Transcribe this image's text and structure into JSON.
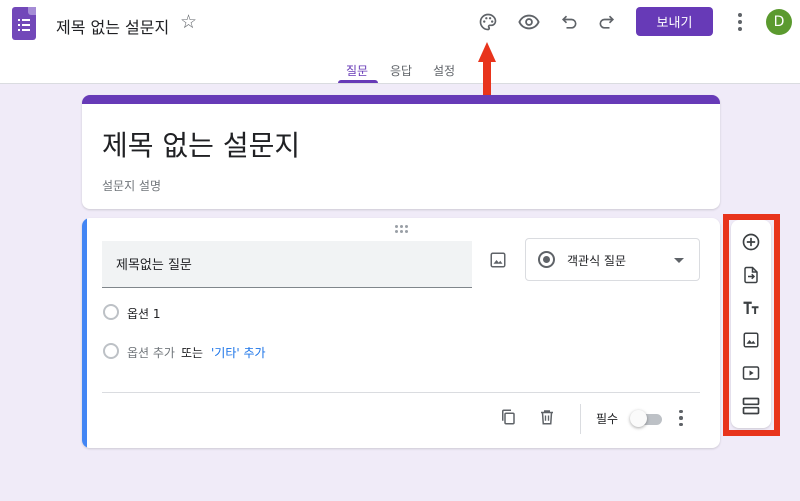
{
  "header": {
    "doc_title": "제목 없는 설문지",
    "send_label": "보내기",
    "avatar_initial": "D",
    "icons": [
      "forms-logo-icon",
      "star-icon",
      "palette-icon",
      "preview-eye-icon",
      "undo-icon",
      "redo-icon",
      "more-vert-icon"
    ]
  },
  "tabs": [
    {
      "label": "질문",
      "active": true
    },
    {
      "label": "응답",
      "active": false
    },
    {
      "label": "설정",
      "active": false
    }
  ],
  "form": {
    "title": "제목 없는 설문지",
    "description": "설문지 설명"
  },
  "question": {
    "title": "제목없는 질문",
    "type": "객관식 질문",
    "options": [
      "옵션 1"
    ],
    "add_option": "옵션 추가",
    "or_text": "또는",
    "add_other": "'기타' 추가",
    "required_label": "필수",
    "required": false
  },
  "side_toolbar": [
    "add-question-icon",
    "import-questions-icon",
    "add-title-text-icon",
    "add-image-icon",
    "add-video-icon",
    "add-section-icon"
  ],
  "colors": {
    "accent": "#673ab7",
    "active_question": "#4285f4",
    "annotation": "#e8341c",
    "background": "#f0ebf8"
  }
}
